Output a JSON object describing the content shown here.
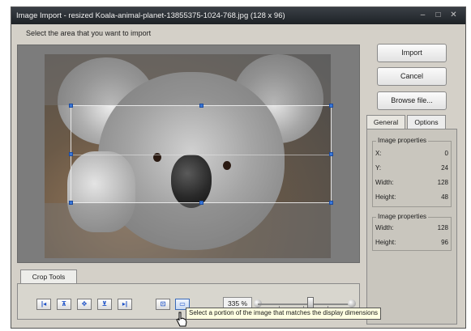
{
  "window": {
    "title": "Image Import - resized Koala-animal-planet-13855375-1024-768.jpg (128 x 96)",
    "controls": [
      "–",
      "□",
      "✕"
    ]
  },
  "instruction": "Select the area that you want to import",
  "buttons": {
    "import": "Import",
    "cancel": "Cancel",
    "browse": "Browse file..."
  },
  "tabs": [
    "General",
    "Options"
  ],
  "crop_props": {
    "title": "Image properties",
    "x_label": "X:",
    "x_value": "0",
    "y_label": "Y:",
    "y_value": "24",
    "width_label": "Width:",
    "width_value": "128",
    "height_label": "Height:",
    "height_value": "48"
  },
  "image_props": {
    "title": "Image properties",
    "width_label": "Width:",
    "width_value": "128",
    "height_label": "Height:",
    "height_value": "96"
  },
  "crop_tools": {
    "tab_label": "Crop Tools",
    "zoom": "335 %",
    "tooltip": "Select a portion of the image that matches the display dimensions"
  }
}
